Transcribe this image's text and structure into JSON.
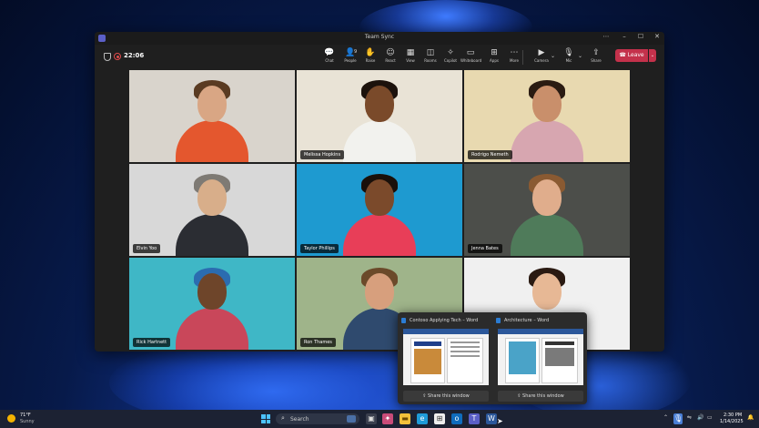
{
  "window": {
    "title": "Team Sync"
  },
  "toolbar": {
    "timer": "22:06",
    "buttons": [
      {
        "label": "Chat",
        "icon": "chat-icon",
        "glyph": "💬"
      },
      {
        "label": "People",
        "icon": "people-icon",
        "glyph": "👤",
        "badge": "9"
      },
      {
        "label": "Raise",
        "icon": "raise-hand-icon",
        "glyph": "✋"
      },
      {
        "label": "React",
        "icon": "react-icon",
        "glyph": "☺"
      },
      {
        "label": "View",
        "icon": "view-icon",
        "glyph": "▦"
      },
      {
        "label": "Rooms",
        "icon": "rooms-icon",
        "glyph": "◫"
      },
      {
        "label": "Copilot",
        "icon": "copilot-icon",
        "glyph": "✧"
      },
      {
        "label": "Whiteboard",
        "icon": "whiteboard-icon",
        "glyph": "▭"
      },
      {
        "label": "Apps",
        "icon": "apps-icon",
        "glyph": "⊞"
      },
      {
        "label": "More",
        "icon": "more-icon",
        "glyph": "⋯"
      },
      {
        "label": "Camera",
        "icon": "camera-icon",
        "glyph": "▶"
      },
      {
        "label": "Mic",
        "icon": "mic-icon",
        "glyph": "🎙"
      },
      {
        "label": "Share",
        "icon": "share-icon",
        "glyph": "⇪"
      }
    ],
    "leave_label": "Leave"
  },
  "participants": [
    {
      "name": "",
      "bg": "#d9d4cc",
      "skin": "#d9a684",
      "hair": "#5a3b22",
      "shirt": "#e4572e"
    },
    {
      "name": "Melissa Hopkins",
      "bg": "#e9e3d6",
      "skin": "#7a4a2a",
      "hair": "#1c120c",
      "shirt": "#f2f2ee"
    },
    {
      "name": "Rodrigo Nemeth",
      "bg": "#e8d9b0",
      "skin": "#c98f6b",
      "hair": "#2a1b12",
      "shirt": "#d7a6b0"
    },
    {
      "name": "Elvin Yoo",
      "bg": "#d8d8d8",
      "skin": "#d8ae8a",
      "hair": "#7e7a74",
      "shirt": "#2b2d33"
    },
    {
      "name": "Taylor Phillips",
      "bg": "#1e9ad0",
      "skin": "#7b4a2b",
      "hair": "#1a100a",
      "shirt": "#e83e58"
    },
    {
      "name": "Jenna Bates",
      "bg": "#4c4e4a",
      "skin": "#e0ad8c",
      "hair": "#8a5a32",
      "shirt": "#4f7b5a"
    },
    {
      "name": "Rick Hartnett",
      "bg": "#3fb7c6",
      "skin": "#6e452a",
      "hair": "#2b6cb0",
      "shirt": "#c9475a"
    },
    {
      "name": "Ron Thames",
      "bg": "#9fb48a",
      "skin": "#d79f7d",
      "hair": "#6b4a2a",
      "shirt": "#2f4a6e"
    },
    {
      "name": "",
      "bg": "#f0f0f0",
      "skin": "#e7b895",
      "hair": "#2a1a12",
      "shirt": "#f5f5f5"
    }
  ],
  "popup": {
    "cards": [
      {
        "title": "Contoso Applying Tech – Word",
        "share_label": "Share this window"
      },
      {
        "title": "Architecture – Word",
        "share_label": "Share this window"
      }
    ]
  },
  "taskbar": {
    "weather_temp": "71°F",
    "weather_desc": "Sunny",
    "search_label": "Search",
    "time": "2:30 PM",
    "date": "1/14/2025"
  },
  "colors": {
    "accent": "#5b5fc7",
    "leave": "#c4314b"
  }
}
